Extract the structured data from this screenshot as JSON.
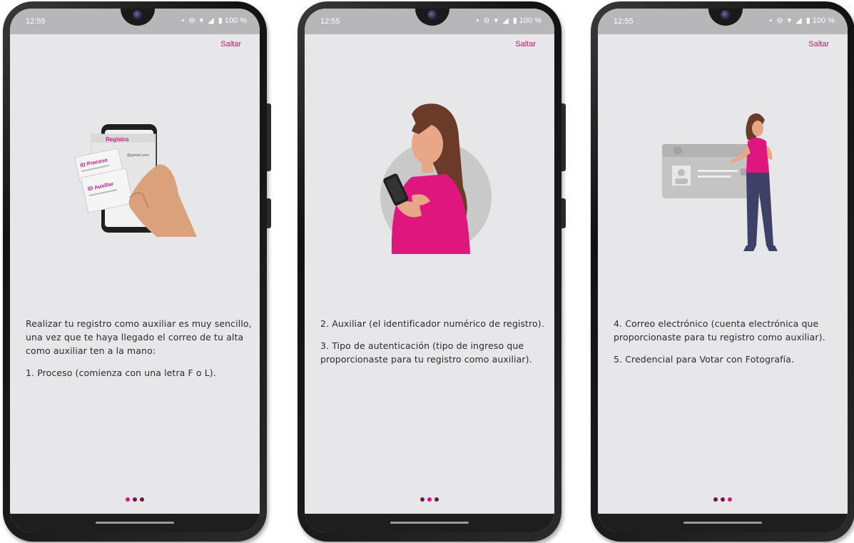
{
  "colors": {
    "accent": "#d3178a",
    "dot_inactive": "#7a1346",
    "skip_text": "#c2186f",
    "screen_background": "#e7e6e8"
  },
  "status_bar": {
    "time": "12:55",
    "battery": "100 %",
    "icons": [
      "camera-icon",
      "notification-dot-icon",
      "do-not-disturb-icon",
      "wifi-icon",
      "signal-icon",
      "battery-icon"
    ]
  },
  "screens": [
    {
      "skip_label": "Saltar",
      "illustration": "hand-holding-phone-with-registration-cards",
      "illustration_text": {
        "registro": "Registro",
        "gmail": "@gmail.com",
        "id_proceso": "ID Proceso",
        "id_auxiliar": "ID Auxiliar"
      },
      "paragraphs": [
        "Realizar tu registro como auxiliar es muy sencillo, una vez que te haya llegado el correo de tu alta como auxiliar ten a la mano:",
        "1. Proceso (comienza con una letra F o L)."
      ],
      "active_dot": 0
    },
    {
      "skip_label": "Saltar",
      "illustration": "woman-using-smartphone",
      "paragraphs": [
        "2. Auxiliar (el identificador numérico de registro).",
        "3. Tipo de autenticación (tipo de ingreso que proporcionaste para tu registro como auxiliar)."
      ],
      "active_dot": 1
    },
    {
      "skip_label": "Saltar",
      "illustration": "woman-presenting-id-card",
      "paragraphs": [
        "4. Correo electrónico (cuenta electrónica que proporcionaste para tu registro como auxiliar).",
        "5. Credencial para Votar con Fotografía."
      ],
      "active_dot": 2
    }
  ]
}
